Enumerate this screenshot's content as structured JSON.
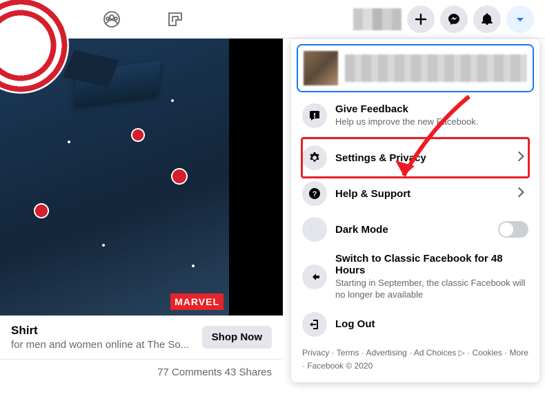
{
  "dropdown": {
    "feedback": {
      "label": "Give Feedback",
      "sub": "Help us improve the new Facebook."
    },
    "settings": {
      "label": "Settings & Privacy"
    },
    "help": {
      "label": "Help & Support"
    },
    "dark": {
      "label": "Dark Mode"
    },
    "switch": {
      "label": "Switch to Classic Facebook for 48 Hours",
      "sub": "Starting in September, the classic Facebook will no longer be available"
    },
    "logout": {
      "label": "Log Out"
    }
  },
  "post": {
    "title": "Shirt",
    "subtitle": "for men and women online at The So...",
    "cta": "Shop Now",
    "badge": "MARVEL",
    "stats": "77 Comments  43 Shares"
  },
  "footer": {
    "privacy": "Privacy",
    "terms": "Terms",
    "advertising": "Advertising",
    "adchoices": "Ad Choices",
    "cookies": "Cookies",
    "more": "More",
    "copyright": "Facebook © 2020"
  }
}
